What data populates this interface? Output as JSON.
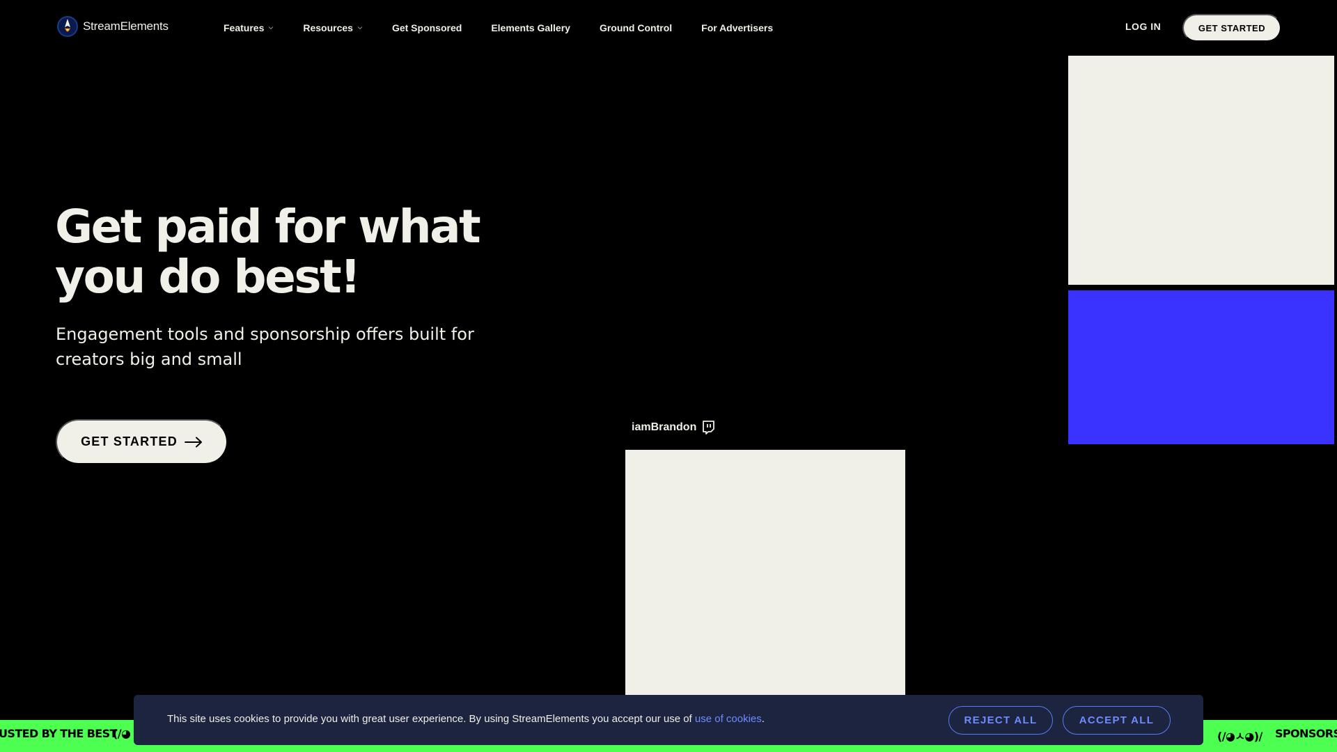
{
  "nav": {
    "brand": "StreamElements",
    "items": [
      {
        "label": "Features",
        "has_dropdown": true
      },
      {
        "label": "Resources",
        "has_dropdown": true
      },
      {
        "label": "Get Sponsored",
        "has_dropdown": false
      },
      {
        "label": "Elements Gallery",
        "has_dropdown": false
      },
      {
        "label": "Ground Control",
        "has_dropdown": false
      },
      {
        "label": "For Advertisers",
        "has_dropdown": false
      }
    ],
    "login_label": "LOG IN",
    "cta_label": "GET STARTED"
  },
  "hero": {
    "title_line1": "Get paid for what",
    "title_line2": "you do best!",
    "subtitle": "Engagement tools and sponsorship offers built for creators big and small",
    "cta_label": "GET STARTED",
    "cta_icon": "arrow-right-icon"
  },
  "showcase": {
    "creator_name": "iamBrandon",
    "platform_icon": "twitch-icon"
  },
  "ticker": {
    "left_text": "USTED BY THE BEST",
    "left_emoticon": "(/◕",
    "right_emoticon": "(/◕ㅅ◕)/",
    "right_text": "SPONSORSH"
  },
  "cookie_banner": {
    "text_before": "This site uses cookies to provide you with great user experience. By using StreamElements you accept our use of ",
    "link_label": "use of cookies",
    "text_after": ".",
    "reject_label": "REJECT ALL",
    "accept_label": "ACCEPT ALL"
  },
  "colors": {
    "background": "#000000",
    "cream": "#f0efe8",
    "blue_tile": "#3a33ff",
    "ticker_green": "#4cff50",
    "cookie_bg": "#1c2440",
    "cookie_accent": "#6c8cff"
  }
}
